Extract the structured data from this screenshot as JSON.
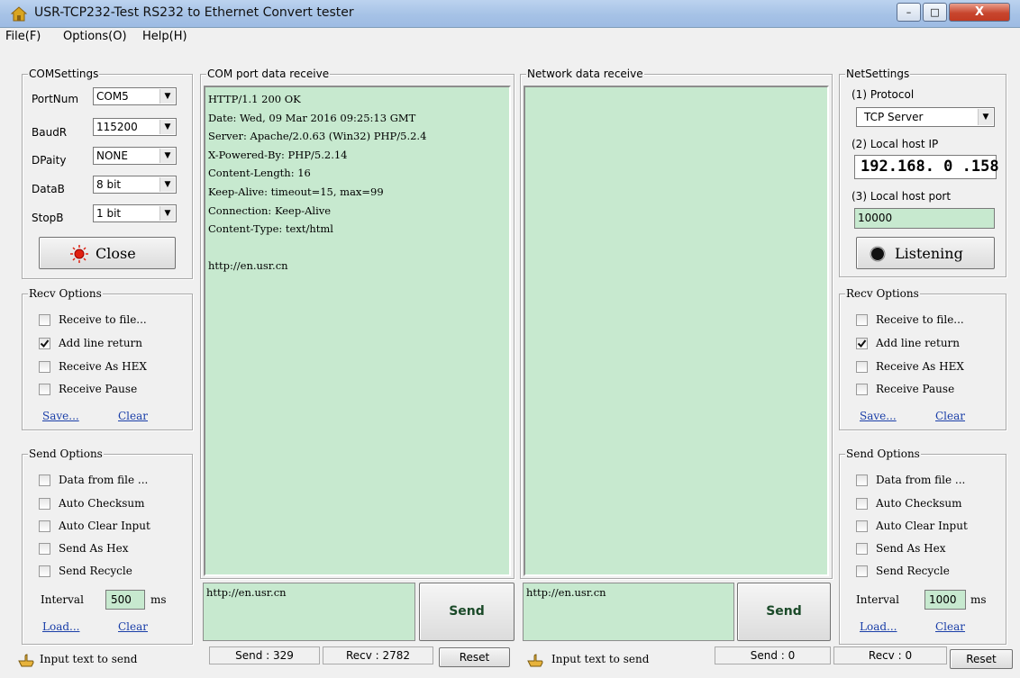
{
  "window": {
    "title": "USR-TCP232-Test  RS232 to Ethernet Convert tester",
    "min": "–",
    "max": "□",
    "close": "X"
  },
  "menu": [
    "File(F)",
    "Options(O)",
    "Help(H)"
  ],
  "com_settings": {
    "legend": "COMSettings",
    "rows": [
      {
        "label": "PortNum",
        "value": "COM5"
      },
      {
        "label": "BaudR",
        "value": "115200"
      },
      {
        "label": "DPaity",
        "value": "NONE"
      },
      {
        "label": "DataB",
        "value": "8 bit"
      },
      {
        "label": "StopB",
        "value": "1 bit"
      }
    ],
    "close_label": "Close"
  },
  "com_receive": {
    "legend": "COM port data receive",
    "text": "HTTP/1.1 200 OK\nDate: Wed, 09 Mar 2016 09:25:13 GMT\nServer: Apache/2.0.63 (Win32) PHP/5.2.4\nX-Powered-By: PHP/5.2.14\nContent-Length: 16\nKeep-Alive: timeout=15, max=99\nConnection: Keep-Alive\nContent-Type: text/html\n\nhttp://en.usr.cn"
  },
  "net_receive": {
    "legend": "Network data receive",
    "text": ""
  },
  "net_settings": {
    "legend": "NetSettings",
    "protocol_label": "(1) Protocol",
    "protocol_value": "TCP Server",
    "ip_label": "(2) Local host IP",
    "ip_parts": [
      "192",
      "168",
      "0",
      "158"
    ],
    "port_label": "(3) Local host port",
    "port_value": "10000",
    "listen_label": "Listening"
  },
  "left_recv_options": {
    "legend": "Recv Options",
    "items": [
      {
        "label": "Receive to file...",
        "checked": false
      },
      {
        "label": "Add line return",
        "checked": true
      },
      {
        "label": "Receive As HEX",
        "checked": false
      },
      {
        "label": "Receive Pause",
        "checked": false
      }
    ],
    "save": "Save...",
    "clear": "Clear"
  },
  "right_recv_options": {
    "legend": "Recv Options",
    "items": [
      {
        "label": "Receive to file...",
        "checked": false
      },
      {
        "label": "Add line return",
        "checked": true
      },
      {
        "label": "Receive As HEX",
        "checked": false
      },
      {
        "label": "Receive Pause",
        "checked": false
      }
    ],
    "save": "Save...",
    "clear": "Clear"
  },
  "left_send_options": {
    "legend": "Send Options",
    "items": [
      {
        "label": "Data from file ...",
        "checked": false
      },
      {
        "label": "Auto Checksum",
        "checked": false
      },
      {
        "label": "Auto Clear Input",
        "checked": false
      },
      {
        "label": "Send As Hex",
        "checked": false
      },
      {
        "label": "Send Recycle",
        "checked": false
      }
    ],
    "interval_label": "Interval",
    "interval_value": "500",
    "interval_unit": "ms",
    "load": "Load...",
    "clear": "Clear"
  },
  "right_send_options": {
    "legend": "Send Options",
    "items": [
      {
        "label": "Data from file ...",
        "checked": false
      },
      {
        "label": "Auto Checksum",
        "checked": false
      },
      {
        "label": "Auto Clear Input",
        "checked": false
      },
      {
        "label": "Send As Hex",
        "checked": false
      },
      {
        "label": "Send Recycle",
        "checked": false
      }
    ],
    "interval_label": "Interval",
    "interval_value": "1000",
    "interval_unit": "ms",
    "load": "Load...",
    "clear": "Clear"
  },
  "com_send": {
    "text": "http://en.usr.cn",
    "button": "Send"
  },
  "net_send": {
    "text": "http://en.usr.cn",
    "button": "Send"
  },
  "status": {
    "left_hint": "Input text to send",
    "com_send_count": "Send : 329",
    "com_recv_count": "Recv : 2782",
    "com_reset": "Reset",
    "right_hint": "Input text to send",
    "net_send_count": "Send : 0",
    "net_recv_count": "Recv : 0",
    "net_reset": "Reset"
  },
  "colors": {
    "receive_bg": "#c7e9cf",
    "link": "#1a3ea8",
    "close_button": "#c8462e"
  }
}
